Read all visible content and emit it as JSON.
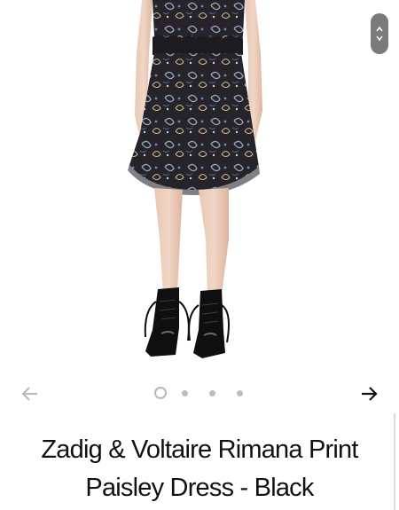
{
  "product": {
    "title_line1": "Zadig & Voltaire Rimana Print",
    "title_line2": "Paisley Dress - Black",
    "image": {
      "subject": "model-wearing-paisley-dress-and-black-boots"
    }
  },
  "gallery": {
    "total_images": 4,
    "active_index": 0
  },
  "icons": {
    "prev": "arrow-left-icon",
    "next": "arrow-right-icon",
    "scroll_up": "chevron-up-icon",
    "scroll_down": "chevron-down-icon"
  },
  "colors": {
    "background": "#ffffff",
    "title_text": "#111111",
    "next_arrow": "#111111",
    "prev_arrow": "#bdbdbd",
    "dot_inactive": "#bdbdbd",
    "scroll_pill": "#7a7a7a"
  }
}
